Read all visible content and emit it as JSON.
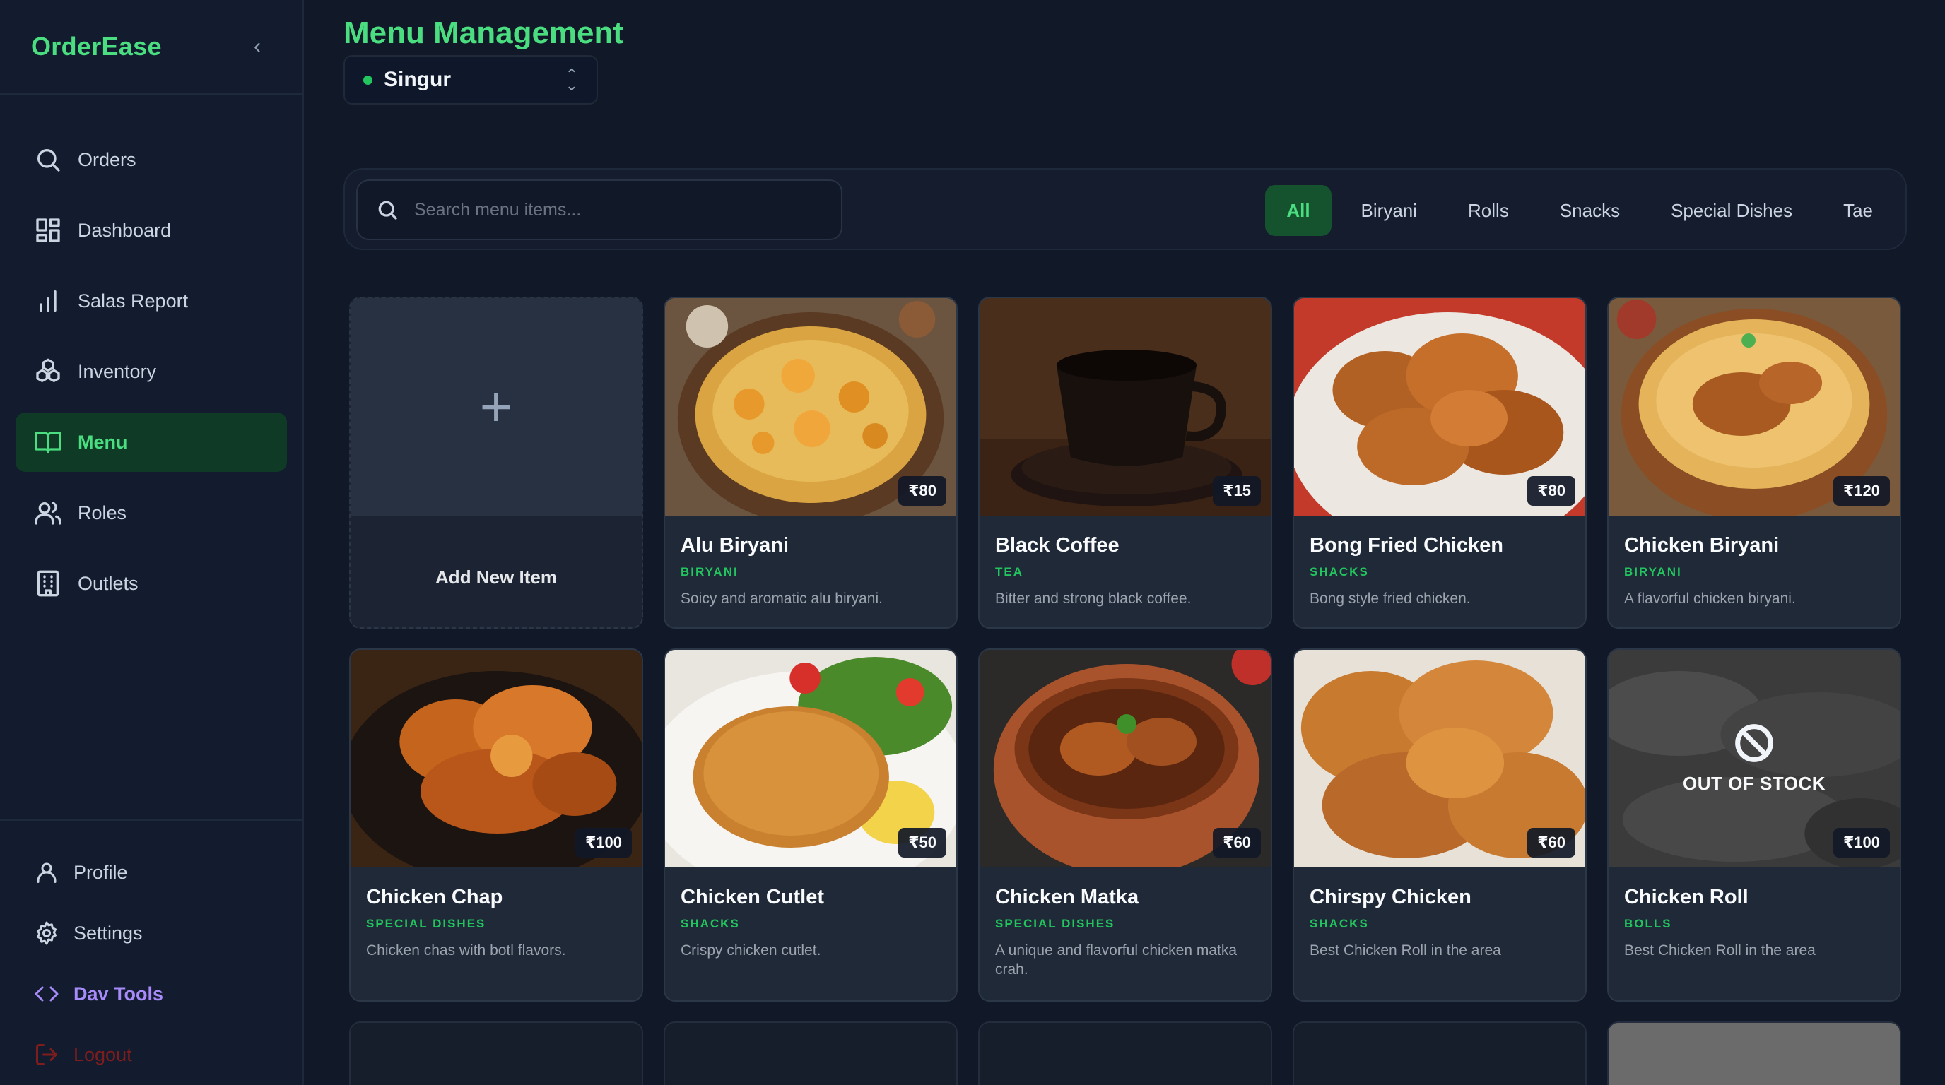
{
  "app": {
    "brand": "OrderEase",
    "collapse_icon": "chevron-left-icon"
  },
  "sidebar": {
    "items": [
      {
        "label": "Orders",
        "icon": "search-icon"
      },
      {
        "label": "Dashboard",
        "icon": "grid-icon"
      },
      {
        "label": "Salas Report",
        "icon": "bar-chart-icon"
      },
      {
        "label": "Inventory",
        "icon": "boxes-icon"
      },
      {
        "label": "Menu",
        "icon": "book-open-icon",
        "active": true
      },
      {
        "label": "Roles",
        "icon": "users-icon"
      },
      {
        "label": "Outlets",
        "icon": "building-icon"
      }
    ],
    "bottom": [
      {
        "label": "Profile",
        "icon": "user-icon"
      },
      {
        "label": "Settings",
        "icon": "gear-icon"
      },
      {
        "label": "Dav Tools",
        "icon": "code-icon"
      },
      {
        "label": "Logout",
        "icon": "logout-icon"
      }
    ]
  },
  "header": {
    "title": "Menu Management",
    "outlet": "Singur"
  },
  "search": {
    "placeholder": "Search menu items..."
  },
  "filters": [
    "All",
    "Biryani",
    "Rolls",
    "Snacks",
    "Special Dishes",
    "Tae"
  ],
  "add_item": {
    "label": "Add New Item"
  },
  "out_of_stock_label": "OUT OF STOCK",
  "items": [
    {
      "name": "Alu Biryani",
      "category": "BIRYANI",
      "description": "Soicy and aromatic alu biryani.",
      "price": "₹80"
    },
    {
      "name": "Black Coffee",
      "category": "TEA",
      "description": "Bitter and strong black coffee.",
      "price": "₹15"
    },
    {
      "name": "Bong Fried Chicken",
      "category": "SHACKS",
      "description": "Bong style fried chicken.",
      "price": "₹80"
    },
    {
      "name": "Chicken Biryani",
      "category": "BIRYANI",
      "description": "A flavorful chicken biryani.",
      "price": "₹120"
    },
    {
      "name": "Chicken Chap",
      "category": "SPECIAL DISHES",
      "description": "Chicken chas with botl flavors.",
      "price": "₹100"
    },
    {
      "name": "Chicken Cutlet",
      "category": "SHACKS",
      "description": "Crispy chicken cutlet.",
      "price": "₹50"
    },
    {
      "name": "Chicken Matka",
      "category": "SPECIAL DISHES",
      "description": "A unique and flavorful chicken matka crah.",
      "price": "₹60"
    },
    {
      "name": "Chirspy Chicken",
      "category": "SHACKS",
      "description": "Best Chicken Roll in the area",
      "price": "₹60"
    },
    {
      "name": "Chicken Roll",
      "category": "BOLLS",
      "description": "Best Chicken Roll in the area",
      "price": "₹100",
      "out_of_stock": true
    }
  ],
  "colors": {
    "accent": "#4ade80",
    "background": "#111827",
    "sidebar": "#131b2e",
    "card": "#1f2937",
    "dev_tools": "#a78bfa",
    "logout": "#7f1d1d"
  }
}
